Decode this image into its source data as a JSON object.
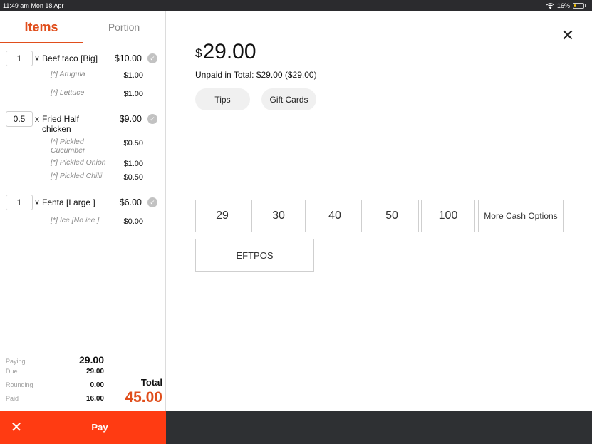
{
  "status_bar": {
    "time_date": "11:49 am  Mon 18 Apr",
    "battery": "16%",
    "battery_level": 0.16
  },
  "tabs": [
    {
      "label": "Items",
      "active": true
    },
    {
      "label": "Portion",
      "active": false
    }
  ],
  "order_items": [
    {
      "qty": "1",
      "x": "x",
      "name": "Beef taco [Big]",
      "price": "$10.00",
      "modifiers": [
        {
          "name": "[*] Arugula",
          "price": "$1.00"
        },
        {
          "name": "[*] Lettuce",
          "price": "$1.00"
        }
      ]
    },
    {
      "qty": "0.5",
      "x": "x",
      "name": "Fried Half chicken",
      "price": "$9.00",
      "modifiers": [
        {
          "name": "[*] Pickled Cucumber",
          "price": "$0.50"
        },
        {
          "name": "[*] Pickled Onion",
          "price": "$1.00"
        },
        {
          "name": "[*] Pickled Chilli",
          "price": "$0.50"
        }
      ]
    },
    {
      "qty": "1",
      "x": "x",
      "name": "Fenta  [Large ]",
      "price": "$6.00",
      "modifiers": [
        {
          "name": "[*] Ice  [No ice ]",
          "price": "$0.00"
        }
      ]
    }
  ],
  "summary": {
    "paying_label": "Paying",
    "paying_value": "29.00",
    "due_label": "Due",
    "due_value": "29.00",
    "rounding_label": "Rounding",
    "rounding_value": "0.00",
    "paid_label": "Paid",
    "paid_value": "16.00",
    "total_label": "Total",
    "total_value": "45.00"
  },
  "bottom": {
    "cancel_icon": "✕",
    "pay_label": "Pay"
  },
  "payment": {
    "currency_symbol": "$",
    "amount": "29.00",
    "unpaid_text": "Unpaid in Total: $29.00 ($29.00)",
    "tips_label": "Tips",
    "gift_cards_label": "Gift Cards",
    "cash_options": [
      "29",
      "30",
      "40",
      "50",
      "100"
    ],
    "more_cash_label": "More Cash Options",
    "eftpos_label": "EFTPOS"
  },
  "colors": {
    "accent": "#e04e1c",
    "action": "#ff3b12",
    "bar": "#2e3033"
  }
}
